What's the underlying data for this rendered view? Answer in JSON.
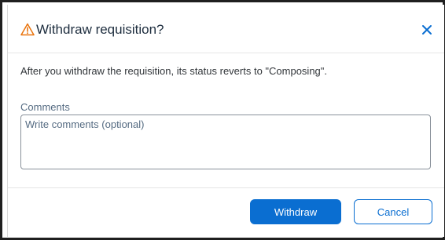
{
  "dialog": {
    "title": "Withdraw requisition?",
    "message": "After you withdraw the requisition, its status reverts to \"Composing\".",
    "comments": {
      "label": "Comments",
      "placeholder": "Write comments (optional)",
      "value": ""
    },
    "buttons": {
      "withdraw_label": "Withdraw",
      "cancel_label": "Cancel"
    },
    "icons": {
      "title_icon": "warning-icon",
      "close_icon": "close-icon"
    }
  },
  "colors": {
    "accent": "#0a6ed1",
    "warning": "#e9730c",
    "title_text": "#1d2d3e",
    "body_text": "#32363a",
    "label_text": "#556b82"
  }
}
